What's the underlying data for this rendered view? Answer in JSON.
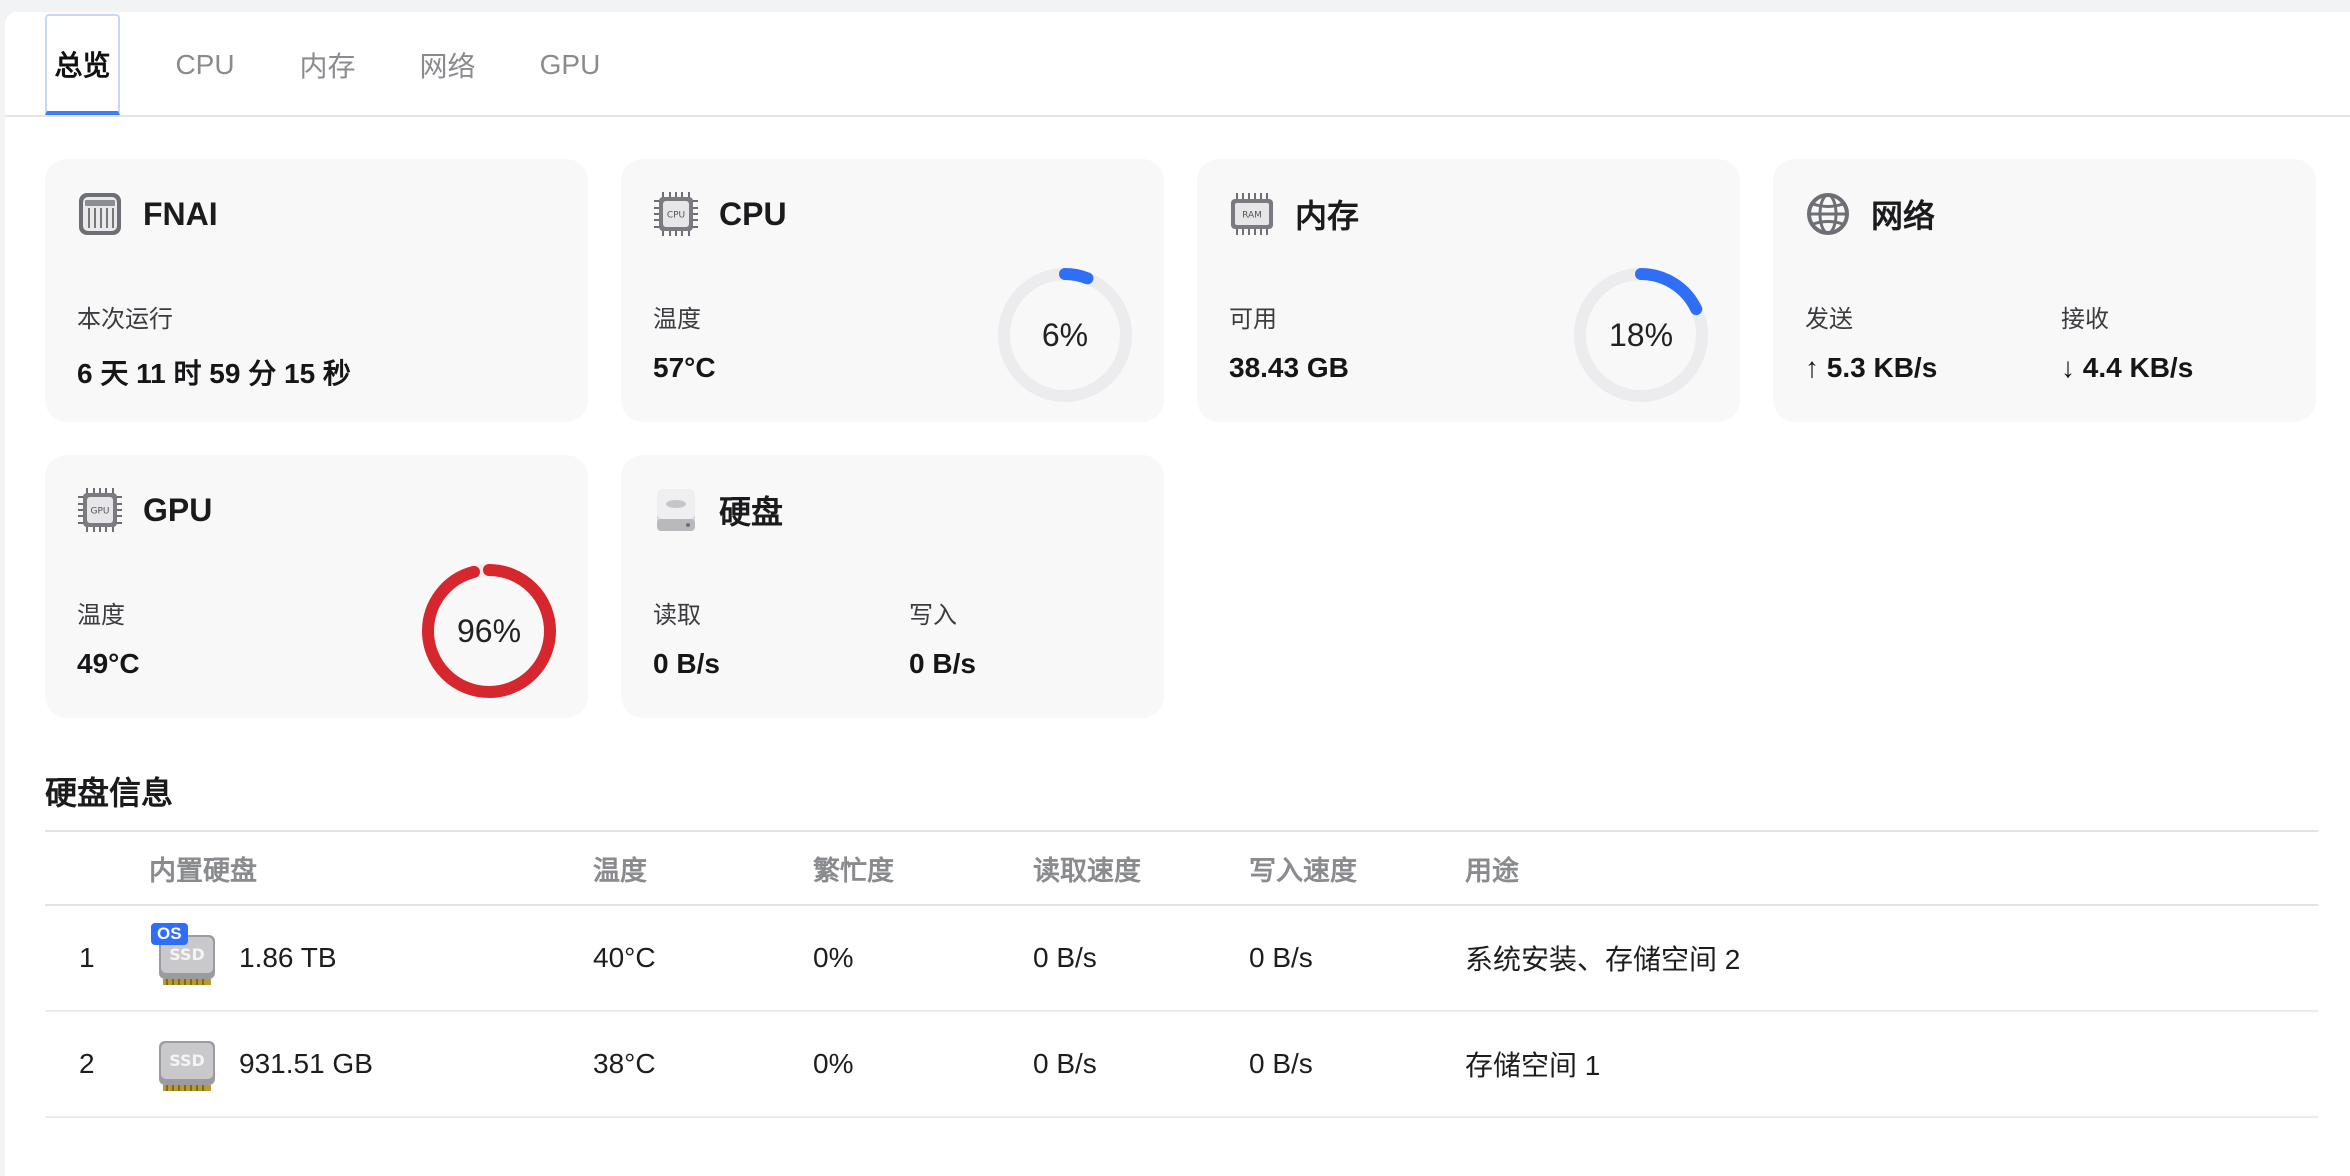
{
  "tabs": [
    {
      "label": "总览",
      "active": true
    },
    {
      "label": "CPU",
      "active": false
    },
    {
      "label": "内存",
      "active": false
    },
    {
      "label": "网络",
      "active": false
    },
    {
      "label": "GPU",
      "active": false
    }
  ],
  "cards": {
    "system": {
      "title": "FNAI",
      "uptime_label": "本次运行",
      "uptime_value": "6 天 11 时 59 分 15 秒"
    },
    "cpu": {
      "title": "CPU",
      "icon_text": "CPU",
      "temp_label": "温度",
      "temp_value": "57°C",
      "usage_text": "6%",
      "usage": 6,
      "gauge_color": "#2f6ef6"
    },
    "memory": {
      "title": "内存",
      "icon_text": "RAM",
      "avail_label": "可用",
      "avail_value": "38.43 GB",
      "usage_text": "18%",
      "usage": 18,
      "gauge_color": "#2f6ef6"
    },
    "network": {
      "title": "网络",
      "send_label": "发送",
      "send_value": "↑ 5.3 KB/s",
      "recv_label": "接收",
      "recv_value": "↓ 4.4 KB/s"
    },
    "gpu": {
      "title": "GPU",
      "icon_text": "GPU",
      "temp_label": "温度",
      "temp_value": "49°C",
      "usage_text": "96%",
      "usage": 96,
      "gauge_color": "#d6272f"
    },
    "disk": {
      "title": "硬盘",
      "read_label": "读取",
      "read_value": "0 B/s",
      "write_label": "写入",
      "write_value": "0 B/s"
    }
  },
  "disk_info": {
    "title": "硬盘信息",
    "columns": {
      "name": "内置硬盘",
      "temp": "温度",
      "busy": "繁忙度",
      "read": "读取速度",
      "write": "写入速度",
      "usage": "用途"
    },
    "rows": [
      {
        "index": "1",
        "icon_text": "SSD",
        "badge": "OS",
        "capacity": "1.86 TB",
        "temp": "40°C",
        "busy": "0%",
        "read": "0 B/s",
        "write": "0 B/s",
        "usage": "系统安装、存储空间 2"
      },
      {
        "index": "2",
        "icon_text": "SSD",
        "badge": "",
        "capacity": "931.51 GB",
        "temp": "38°C",
        "busy": "0%",
        "read": "0 B/s",
        "write": "0 B/s",
        "usage": "存储空间 1"
      }
    ]
  },
  "colors": {
    "accent": "#3b7cf6",
    "gauge_track": "#ececee",
    "gpu_gauge": "#d6272f"
  },
  "icons": {
    "system": "server-chassis-icon",
    "cpu": "cpu-chip-icon",
    "memory": "ram-module-icon",
    "network": "globe-icon",
    "gpu": "gpu-chip-icon",
    "disk": "hard-drive-icon",
    "ssd": "ssd-drive-icon"
  }
}
